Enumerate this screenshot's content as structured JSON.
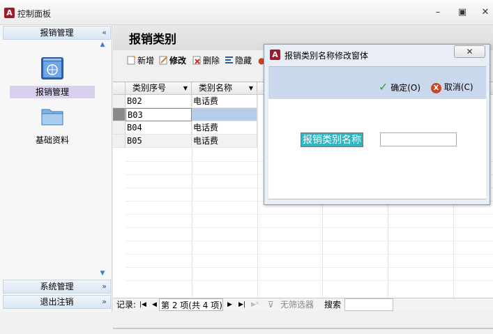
{
  "window": {
    "app_icon_letter": "A",
    "title": "控制面板",
    "controls": [
      "minimize-icon",
      "restore-icon",
      "close-icon"
    ]
  },
  "sidebar": {
    "groups": [
      {
        "label": "报销管理",
        "chevron": "«"
      },
      {
        "label": "系统管理",
        "chevron": "»"
      },
      {
        "label": "退出注销",
        "chevron": "»"
      }
    ],
    "items": [
      {
        "label": "报销管理",
        "icon": "browser-window-icon",
        "selected": true
      },
      {
        "label": "基础资料",
        "icon": "folder-icon",
        "selected": false
      }
    ]
  },
  "main": {
    "title": "报销类别",
    "toolbar": [
      {
        "label": "新增",
        "icon": "new-icon"
      },
      {
        "label": "修改",
        "icon": "edit-icon"
      },
      {
        "label": "删除",
        "icon": "delete-icon"
      },
      {
        "label": "隐藏",
        "icon": "hide-icon"
      }
    ]
  },
  "grid": {
    "columns": [
      "类别序号",
      "类别名称"
    ],
    "rows": [
      [
        "B02",
        "电话费"
      ],
      [
        "B03",
        ""
      ],
      [
        "B04",
        "电话费"
      ],
      [
        "B05",
        "电话费"
      ]
    ],
    "selected_row": 1
  },
  "navbar": {
    "record_label": "记录:",
    "position": "第 2 项(共 4 项)",
    "filter_label": "无筛选器",
    "search_label": "搜索"
  },
  "dialog": {
    "icon_letter": "A",
    "title": "报销类别名称修改窗体",
    "close_symbol": "✕",
    "ok_label": "确定",
    "ok_shortcut": "(O)",
    "cancel_label": "取消",
    "cancel_shortcut": "(C)",
    "field_label": "报销类别名称",
    "field_value": ""
  },
  "colors": {
    "accent": "#a01a2c",
    "dialog_band": "#c9d8ec",
    "field_label_bg": "#2eb7c3",
    "selected_row": "#b5cde8",
    "sidebar_selected": "#d8d0ec"
  }
}
